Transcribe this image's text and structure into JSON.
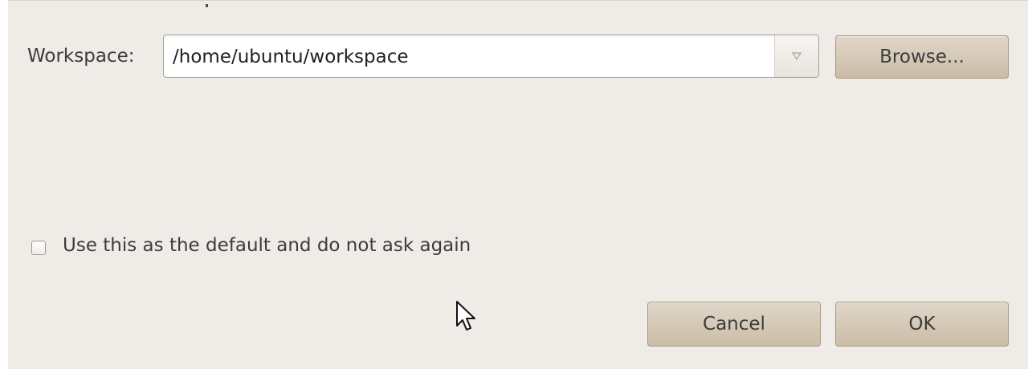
{
  "workspace": {
    "label": "Workspace:",
    "value": "/home/ubuntu/workspace",
    "dropdown_icon": "triangle-down-icon",
    "browse_label": "Browse..."
  },
  "default_option": {
    "label": "Use this as the default and do not ask again",
    "checked": false
  },
  "actions": {
    "cancel_label": "Cancel",
    "ok_label": "OK"
  },
  "cursor_icon": "mouse-pointer-icon",
  "colors": {
    "dialog_bg": "#efebe6",
    "button_bg": "#d6c9b6",
    "text": "#3c3c3c"
  }
}
